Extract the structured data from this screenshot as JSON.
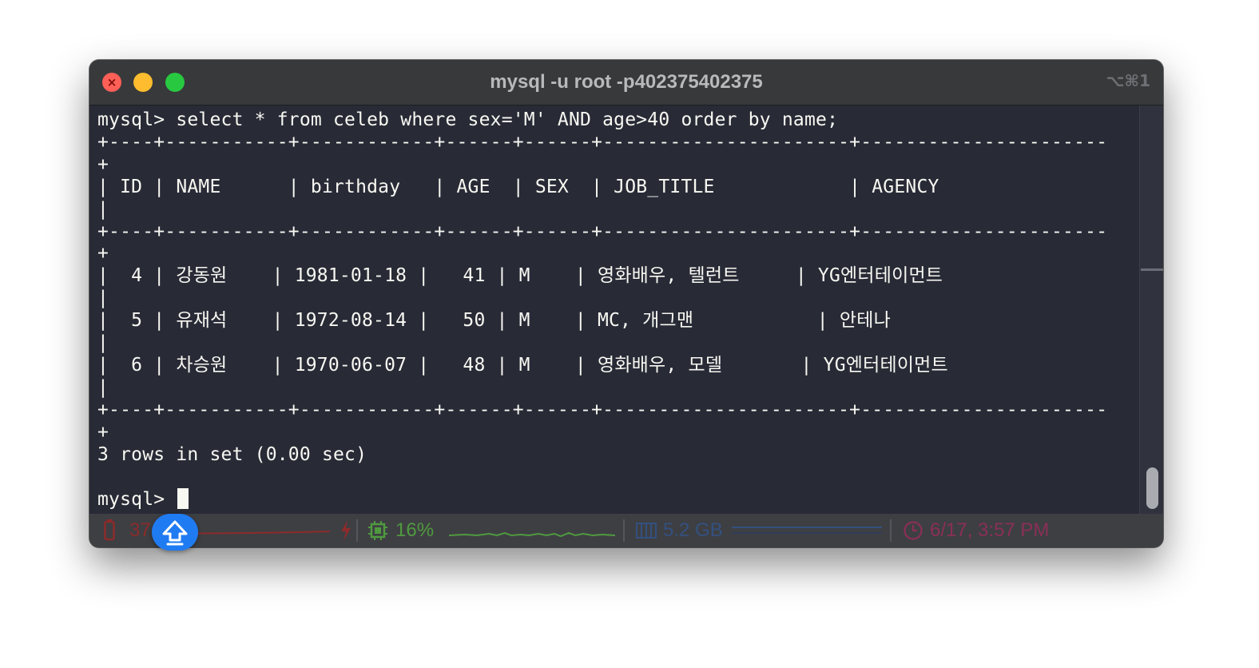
{
  "window": {
    "title": "mysql -u root -p402375402375",
    "shortcut": "⌥⌘1"
  },
  "terminal": {
    "lines": [
      "mysql> select * from celeb where sex='M' AND age>40 order by name;",
      "+----+-----------+------------+------+------+----------------------+----------------------",
      "+",
      "| ID | NAME      | birthday   | AGE  | SEX  | JOB_TITLE            | AGENCY",
      "|",
      "+----+-----------+------------+------+------+----------------------+----------------------",
      "+",
      "|  4 | 강동원    | 1981-01-18 |   41 | M    | 영화배우, 텔런트     | YG엔터테이먼트",
      "|",
      "|  5 | 유재석    | 1972-08-14 |   50 | M    | MC, 개그맨           | 안테나",
      "|",
      "|  6 | 차승원    | 1970-06-07 |   48 | M    | 영화배우, 모델       | YG엔터테이먼트",
      "|",
      "+----+-----------+------------+------+------+----------------------+----------------------",
      "+",
      "3 rows in set (0.00 sec)",
      ""
    ],
    "prompt": "mysql> "
  },
  "statusbar": {
    "battery_value": "37",
    "cpu_value": "16%",
    "memory_value": "5.2 GB",
    "datetime": "6/17, 3:57 PM",
    "colors": {
      "battery": "#8c2b2b",
      "cpu": "#4f9a3f",
      "memory": "#33507f",
      "clock": "#8a2f57"
    }
  }
}
